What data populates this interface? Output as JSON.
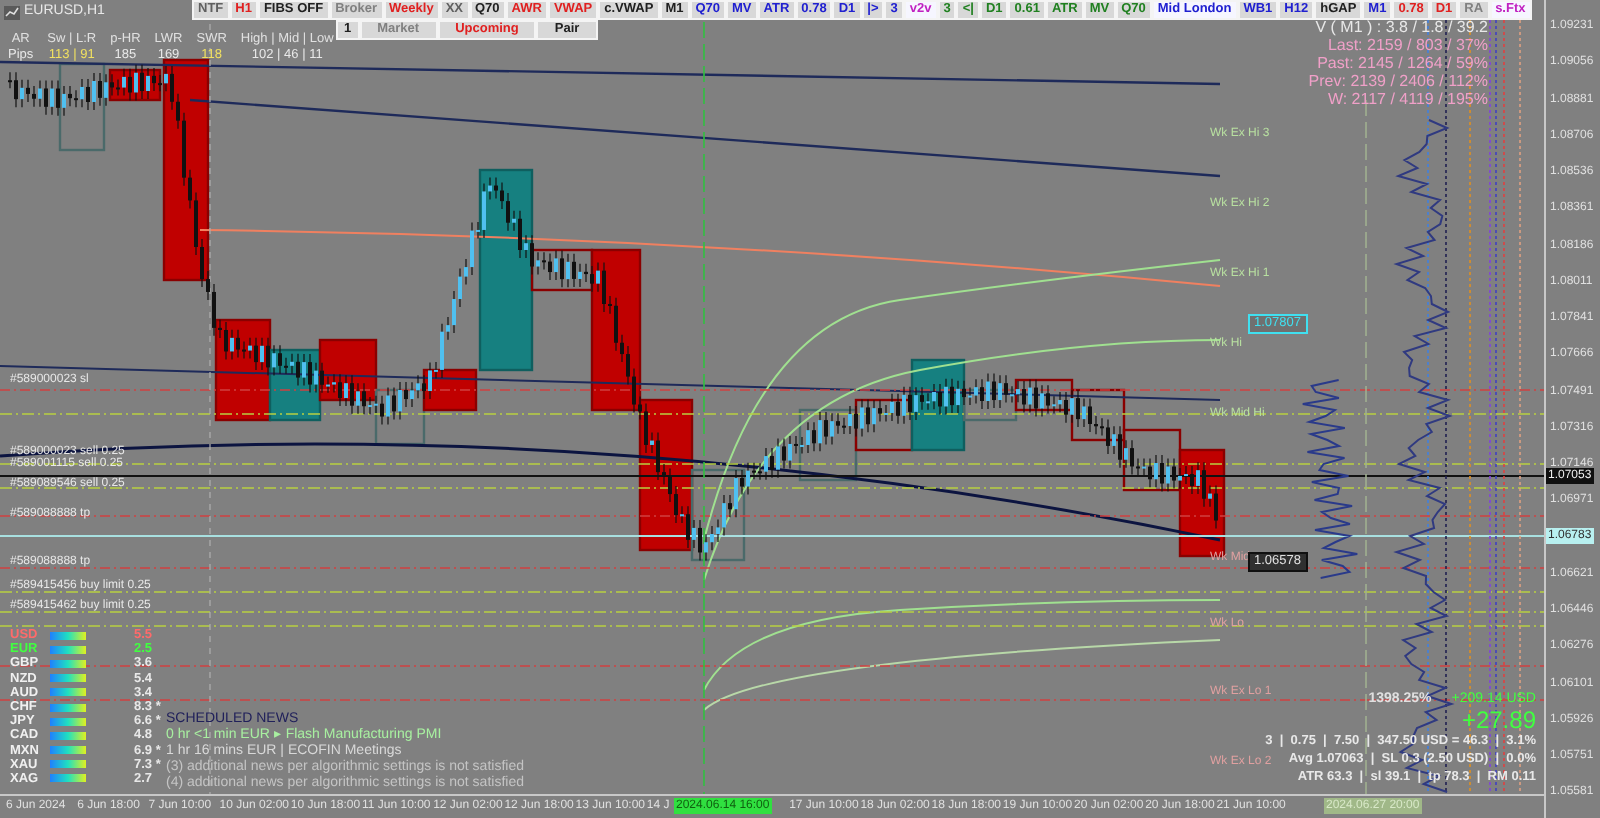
{
  "window": {
    "title": "EURUSD,H1"
  },
  "toolbar": [
    {
      "label": "NTF",
      "color": "#606060",
      "highlighted": false
    },
    {
      "label": "H1",
      "color": "#e02020",
      "highlighted": false
    },
    {
      "label": "FIBS OFF",
      "color": "#202020",
      "highlighted": false
    },
    {
      "label": "Broker",
      "color": "#808080",
      "highlighted": false
    },
    {
      "label": "Weekly",
      "color": "#e02020",
      "highlighted": false
    },
    {
      "label": "XX",
      "color": "#606060",
      "highlighted": false
    },
    {
      "label": "Q70",
      "color": "#202020",
      "highlighted": false
    },
    {
      "label": "AWR",
      "color": "#e02020",
      "highlighted": false
    },
    {
      "label": "VWAP",
      "color": "#e02020",
      "highlighted": false
    },
    {
      "label": "c.VWAP",
      "color": "#202020",
      "highlighted": false
    },
    {
      "label": "M1",
      "color": "#202020",
      "highlighted": false
    },
    {
      "label": "Q70",
      "color": "#2020d0",
      "highlighted": false
    },
    {
      "label": "MV",
      "color": "#2020d0",
      "highlighted": false
    },
    {
      "label": "ATR",
      "color": "#2020d0",
      "highlighted": false
    },
    {
      "label": "0.78",
      "color": "#2020d0",
      "highlighted": false
    },
    {
      "label": "D1",
      "color": "#2020d0",
      "highlighted": false
    },
    {
      "label": "|>",
      "color": "#2020d0",
      "highlighted": false
    },
    {
      "label": "3",
      "color": "#2020d0",
      "highlighted": false
    },
    {
      "label": "v2v",
      "color": "#c020c0",
      "highlighted": true
    },
    {
      "label": "3",
      "color": "#208020",
      "highlighted": false
    },
    {
      "label": "<|",
      "color": "#208020",
      "highlighted": false
    },
    {
      "label": "D1",
      "color": "#208020",
      "highlighted": false
    },
    {
      "label": "0.61",
      "color": "#208020",
      "highlighted": false
    },
    {
      "label": "ATR",
      "color": "#208020",
      "highlighted": false
    },
    {
      "label": "MV",
      "color": "#208020",
      "highlighted": false
    },
    {
      "label": "Q70",
      "color": "#208020",
      "highlighted": false
    },
    {
      "label": "Mid London",
      "color": "#2020d0",
      "highlighted": true
    },
    {
      "label": "WB1",
      "color": "#2020d0",
      "highlighted": false
    },
    {
      "label": "H12",
      "color": "#2020d0",
      "highlighted": false
    },
    {
      "label": "hGAP",
      "color": "#202020",
      "highlighted": false
    },
    {
      "label": "M1",
      "color": "#2020d0",
      "highlighted": false
    },
    {
      "label": "0.78",
      "color": "#e02020",
      "highlighted": false
    },
    {
      "label": "D1",
      "color": "#e02020",
      "highlighted": false
    },
    {
      "label": "RA",
      "color": "#808080",
      "highlighted": false
    },
    {
      "label": "s.Ftx",
      "color": "#c020c0",
      "highlighted": true
    }
  ],
  "toolbar_2": [
    {
      "label": "1",
      "color": "#202020"
    },
    {
      "label": "Market",
      "color": "#808080"
    },
    {
      "label": "Upcoming",
      "color": "#e02020"
    },
    {
      "label": "Pair",
      "color": "#202020"
    }
  ],
  "range_stats": [
    {
      "label": "AR",
      "value": "Pips",
      "color": "#e8e8e8"
    },
    {
      "label": "Sw | L:R",
      "value": "113 | 91",
      "color": "#f0e060"
    },
    {
      "label": "p-HR",
      "value": "185",
      "color": "#e8e8e8"
    },
    {
      "label": "LWR",
      "value": "169",
      "color": "#e8e8e8"
    },
    {
      "label": "SWR",
      "value": "118",
      "color": "#f0e060"
    },
    {
      "label": "High | Mid | Low",
      "value": "102 | 46 | 11",
      "color": "#e8e8e8"
    }
  ],
  "volume_stats": [
    "V ( M1 ) : 3.8 / 1.8 / 39.2",
    "Last: 2159 / 803 / 37%",
    "Past: 2145 / 1264 / 59%",
    "Prev: 2139 / 2406 / 112%",
    "W: 2117 / 4119 / 195%"
  ],
  "orders": [
    "#589000023 sl",
    "#589000023 sell 0.25",
    "#589001115 sell 0.25",
    "#589089546 sell 0.25",
    "#589088888 tp",
    "#589088888 tp",
    "#589415456 buy limit 0.25",
    "#589415462 buy limit 0.25"
  ],
  "levels": [
    {
      "label": "Wk Ex Hi 3",
      "kind": "high"
    },
    {
      "label": "Wk Ex Hi 2",
      "kind": "high"
    },
    {
      "label": "Wk Ex Hi 1",
      "kind": "high"
    },
    {
      "label": "Wk Hi",
      "kind": "high"
    },
    {
      "label": "Wk Mid Hi",
      "kind": "high"
    },
    {
      "label": "Wk Mid",
      "kind": "low"
    },
    {
      "label": "Wk Lo",
      "kind": "low"
    },
    {
      "label": "Wk Ex Lo 1",
      "kind": "low"
    },
    {
      "label": "Wk Ex Lo 2",
      "kind": "low"
    }
  ],
  "price_tags": [
    {
      "label": "1.07807",
      "kind": "outline"
    },
    {
      "label": "1.06578",
      "kind": "dark"
    }
  ],
  "currency_strength": [
    {
      "name": "USD",
      "value": "5.5",
      "color": "#ff6a6a"
    },
    {
      "name": "EUR",
      "value": "2.5",
      "color": "#40ff40"
    },
    {
      "name": "GBP",
      "value": "3.6",
      "color": "#f0f0f0"
    },
    {
      "name": "NZD",
      "value": "5.4",
      "color": "#f0f0f0"
    },
    {
      "name": "AUD",
      "value": "3.4",
      "color": "#f0f0f0"
    },
    {
      "name": "CHF",
      "value": "8.3 *",
      "color": "#f0f0f0"
    },
    {
      "name": "JPY",
      "value": "6.6 *",
      "color": "#f0f0f0"
    },
    {
      "name": "CAD",
      "value": "4.8",
      "color": "#f0f0f0"
    },
    {
      "name": "MXN",
      "value": "6.9 *",
      "color": "#f0f0f0"
    },
    {
      "name": "XAU",
      "value": "7.3 *",
      "color": "#f0f0f0"
    },
    {
      "name": "XAG",
      "value": "2.7",
      "color": "#f0f0f0"
    }
  ],
  "news": {
    "title": "SCHEDULED NEWS",
    "items": [
      {
        "text": "0 hr <1 min  EUR  ▸  Flash Manufacturing PMI",
        "kind": "next"
      },
      {
        "text": "1 hr 16 mins  EUR  |  ECOFIN Meetings",
        "kind": "upcoming"
      },
      {
        "text": "(3) additional news per algorithmic settings is not satisfied",
        "kind": "filtered"
      },
      {
        "text": "(4) additional news per algorithmic settings is not satisfied",
        "kind": "filtered"
      }
    ]
  },
  "trade_summary": {
    "percent": "1398.25%",
    "profit": "+209.14 USD",
    "pips": "+27.89",
    "lines": [
      "3  |  0.75  |  7.50  |  347.50 USD = 46.3  |  3.1%",
      "Avg 1.07063  |  SL 0.3 (2.50 USD)  |  0.0%",
      "ATR 63.3  |  sl 39.1  |  tp 78.3  |  RM 0.11"
    ]
  },
  "price_axis": {
    "ticks": [
      "1.09231",
      "1.09056",
      "1.08881",
      "1.08706",
      "1.08536",
      "1.08361",
      "1.08186",
      "1.08011",
      "1.07841",
      "1.07666",
      "1.07491",
      "1.07316",
      "1.07146",
      "1.06971",
      "1.06621",
      "1.06446",
      "1.06276",
      "1.06101",
      "1.05926",
      "1.05751",
      "1.05581"
    ],
    "bid": "1.07053",
    "marker": "1.06783"
  },
  "time_axis": {
    "ticks": [
      "6 Jun 2024",
      "6 Jun 18:00",
      "7 Jun 10:00",
      "10 Jun 02:00",
      "10 Jun 18:00",
      "11 Jun 10:00",
      "12 Jun 02:00",
      "12 Jun 18:00",
      "13 Jun 10:00",
      "14 J",
      "17 Jun 10:00",
      "18 Jun 02:00",
      "18 Jun 18:00",
      "19 Jun 10:00",
      "20 Jun 02:00",
      "20 Jun 18:00",
      "21 Jun 10:00"
    ],
    "cursor": "2024.06.14 16:00",
    "end": "2024.06.27 20:00"
  }
}
